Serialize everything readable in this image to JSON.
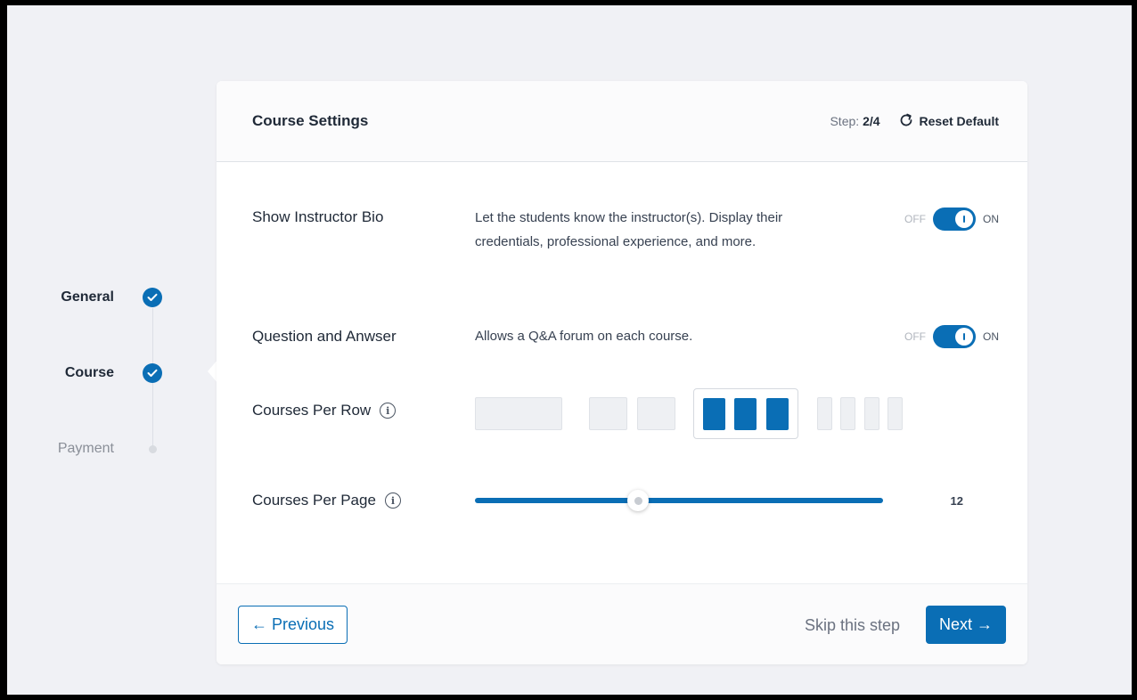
{
  "steps": [
    {
      "label": "General",
      "state": "done"
    },
    {
      "label": "Course",
      "state": "done"
    },
    {
      "label": "Payment",
      "state": "pending"
    }
  ],
  "header": {
    "title": "Course Settings",
    "step_prefix": "Step: ",
    "step_value": "2/4",
    "reset_label": "Reset Default"
  },
  "settings": {
    "instructor_bio": {
      "label": "Show Instructor Bio",
      "description": "Let the students know the instructor(s). Display their credentials, professional experience, and more.",
      "off_label": "OFF",
      "on_label": "ON",
      "enabled": true
    },
    "qa": {
      "label": "Question and Anwser",
      "description": "Allows a Q&A forum on each course.",
      "off_label": "OFF",
      "on_label": "ON",
      "enabled": true
    },
    "courses_per_row": {
      "label": "Courses Per Row",
      "options": [
        1,
        2,
        3,
        4
      ],
      "selected": 3
    },
    "courses_per_page": {
      "label": "Courses Per Page",
      "value": "12",
      "fraction": 0.4
    }
  },
  "footer": {
    "previous_label": "← Previous",
    "skip_label": "Skip this step",
    "next_label": "Next →"
  },
  "colors": {
    "accent": "#0a6eb5",
    "background": "#f0f1f5"
  }
}
